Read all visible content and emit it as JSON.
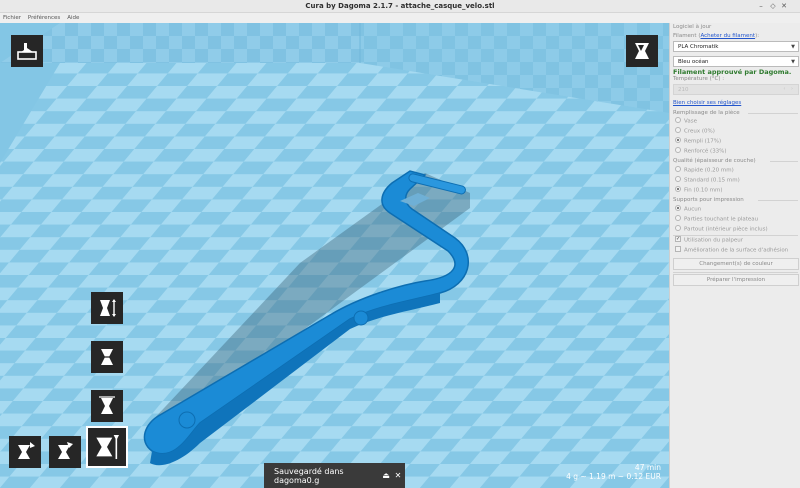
{
  "window": {
    "title": "Cura by Dagoma 2.1.7 - attache_casque_velo.stl",
    "buttons": {
      "minimize": "–",
      "maximize": "◇",
      "close": "✕"
    }
  },
  "menu": [
    "Fichier",
    "Préférences",
    "Aide"
  ],
  "viewport": {
    "colors": {
      "bed_light": "#9fd6ef",
      "bed_dark": "#7fc2e2",
      "model": "#1a8ad4",
      "model_edge": "#0d6fb4"
    },
    "tools_left": [
      {
        "name": "scale-tool-icon"
      },
      {
        "name": "mirror-tool-icon"
      },
      {
        "name": "rotate-tool-icon"
      },
      {
        "name": "rotate-x-tool-icon"
      },
      {
        "name": "rotate-y-tool-icon"
      },
      {
        "name": "rotate-z-tool-icon"
      }
    ]
  },
  "toast": {
    "text": "Sauvegardé dans dagoma0.g",
    "eject_icon": "⏏",
    "close_icon": "✕"
  },
  "print_info": {
    "time": "47 min",
    "summary": "4 g ~ 1.19 m ~ 0.12 EUR"
  },
  "panel": {
    "update_label": "Logiciel à jour",
    "filament_label": "Filament (",
    "filament_link": "Acheter du filament",
    "filament_label_end": "):",
    "filament_type": "PLA Chromatik",
    "filament_color": "Bleu océan",
    "approved_text": "Filament approuvé par Dagoma.",
    "temperature_label": "Température (°C) :",
    "temperature_value": "210",
    "settings_link": "Bien choisir ses réglages",
    "fill": {
      "title": "Remplissage de la pièce",
      "options": [
        "Vase",
        "Creux (0%)",
        "Rempli (17%)",
        "Renforcé (33%)"
      ],
      "selected": 2
    },
    "quality": {
      "title": "Qualité (épaisseur de couche)",
      "options": [
        "Rapide (0.20 mm)",
        "Standard (0.15 mm)",
        "Fin (0.10 mm)"
      ],
      "selected": 2
    },
    "supports": {
      "title": "Supports pour impression",
      "options": [
        "Aucun",
        "Parties touchant le plateau",
        "Partout (intérieur pièce inclus)"
      ],
      "selected": 0
    },
    "checks": [
      {
        "label": "Utilisation du palpeur",
        "checked": true
      },
      {
        "label": "Amélioration de la surface d'adhésion",
        "checked": false
      }
    ],
    "color_change_button": "Changement(s) de couleur",
    "prepare_button": "Préparer l'impression"
  }
}
